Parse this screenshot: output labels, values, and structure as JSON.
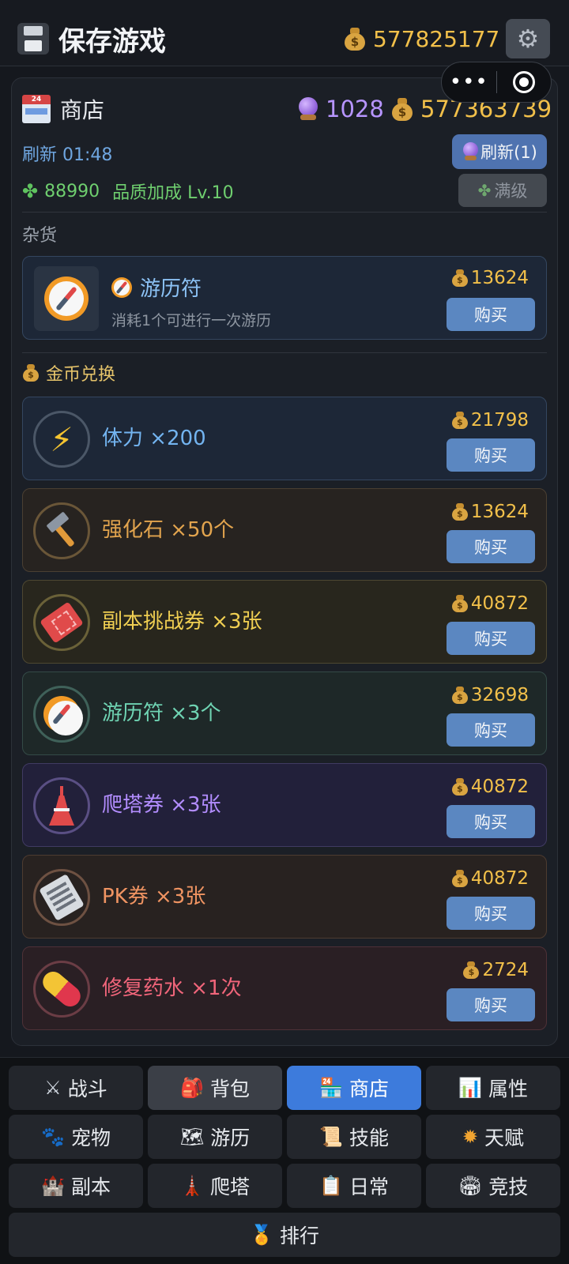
{
  "header": {
    "save_label": "保存游戏",
    "gold": "577825177"
  },
  "capsule": {
    "more": "•••"
  },
  "shop": {
    "title": "商店",
    "crystal": "1028",
    "gold": "577363739",
    "refresh_timer": "刷新 01:48",
    "refresh_button": "刷新(1)",
    "clover_count": "88990",
    "quality_bonus": "品质加成 Lv.10",
    "max_button": "满级",
    "sundry_section": "杂货",
    "sundry_item": {
      "name": "游历符",
      "desc": "消耗1个可进行一次游历",
      "price": "13624",
      "buy": "购买"
    },
    "exchange_section": "金币兑换",
    "items": [
      {
        "name": "体力 ×200",
        "price": "21798",
        "buy": "购买"
      },
      {
        "name": "强化石 ×50个",
        "price": "13624",
        "buy": "购买"
      },
      {
        "name": "副本挑战券 ×3张",
        "price": "40872",
        "buy": "购买"
      },
      {
        "name": "游历符 ×3个",
        "price": "32698",
        "buy": "购买"
      },
      {
        "name": "爬塔券 ×3张",
        "price": "40872",
        "buy": "购买"
      },
      {
        "name": "PK券 ×3张",
        "price": "40872",
        "buy": "购买"
      },
      {
        "name": "修复药水 ×1次",
        "price": "2724",
        "buy": "购买"
      }
    ]
  },
  "nav": [
    {
      "label": "战斗",
      "icon": "⚔"
    },
    {
      "label": "背包",
      "icon": "🎒"
    },
    {
      "label": "商店",
      "icon": "🏪"
    },
    {
      "label": "属性",
      "icon": "📊"
    },
    {
      "label": "宠物",
      "icon": "🐾"
    },
    {
      "label": "游历",
      "icon": "🗺"
    },
    {
      "label": "技能",
      "icon": "📜"
    },
    {
      "label": "天赋",
      "icon": "✹"
    },
    {
      "label": "副本",
      "icon": "🏰"
    },
    {
      "label": "爬塔",
      "icon": "🗼"
    },
    {
      "label": "日常",
      "icon": "📋"
    },
    {
      "label": "竞技",
      "icon": "🏟"
    },
    {
      "label": "排行",
      "icon": "🏅"
    }
  ],
  "colors": {
    "background": "#15181e",
    "gold_text": "#f2c04a",
    "crystal_text": "#b795ff",
    "active_tab": "#3d7bdc",
    "buy_button": "#5b87c1"
  }
}
